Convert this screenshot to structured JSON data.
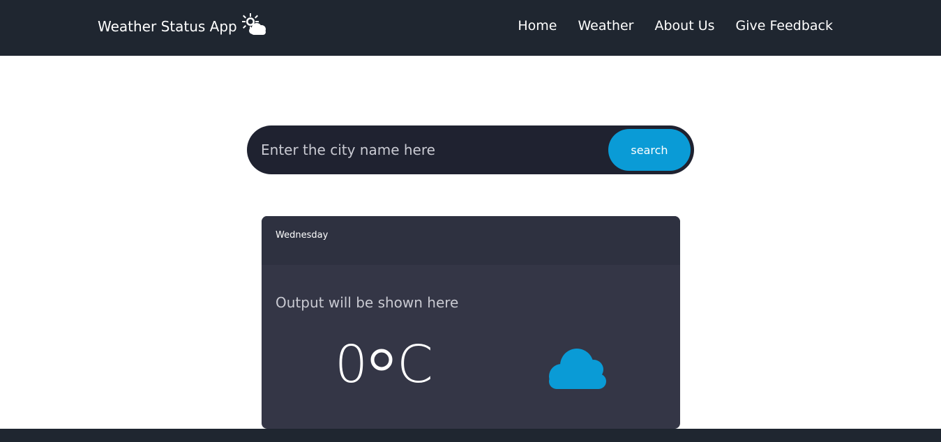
{
  "navbar": {
    "brand": "Weather Status App",
    "brand_icon": "sun-cloud-icon",
    "links": [
      {
        "label": "Home"
      },
      {
        "label": "Weather"
      },
      {
        "label": "About Us"
      },
      {
        "label": "Give Feedback"
      }
    ]
  },
  "search": {
    "placeholder": "Enter the city name here",
    "value": "",
    "button_label": "search"
  },
  "weather_card": {
    "day": "Wednesday",
    "output_text": "Output will be shown here",
    "temperature": "0",
    "unit_degree": "o",
    "unit": "C",
    "condition_icon": "cloud-icon"
  },
  "colors": {
    "navbar_bg": "#1f2630",
    "accent": "#0a9bd6",
    "card_bg": "#343646"
  }
}
